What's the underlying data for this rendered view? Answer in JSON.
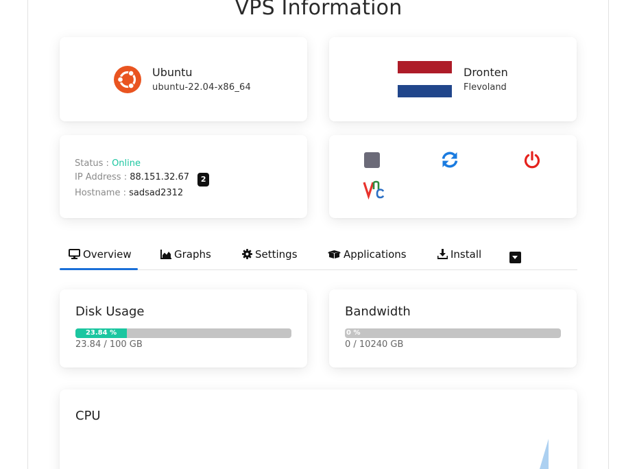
{
  "page": {
    "title": "VPS Information"
  },
  "os": {
    "name": "Ubuntu",
    "image": "ubuntu-22.04-x86_64",
    "icon": "ubuntu-logo-icon"
  },
  "location": {
    "city": "Dronten",
    "region": "Flevoland",
    "flag": "netherlands-flag-icon",
    "flag_colors": [
      "#AE1C28",
      "#FFFFFF",
      "#21468B"
    ]
  },
  "status": {
    "status_label": "Status :",
    "status_value": "Online",
    "ip_label": "IP Address :",
    "ip_value": "88.151.32.67",
    "ip_count": "2",
    "hostname_label": "Hostname :",
    "hostname_value": "sadsad2312"
  },
  "controls": {
    "stop": "stop-icon",
    "restart": "restart-icon",
    "power": "power-icon",
    "vnc": "vnc-icon",
    "colors": {
      "stop": "#6b6a78",
      "restart": "#1a7be0",
      "power": "#e5221d"
    }
  },
  "tabs": [
    {
      "label": "Overview",
      "icon": "monitor-icon",
      "active": true
    },
    {
      "label": "Graphs",
      "icon": "area-chart-icon"
    },
    {
      "label": "Settings",
      "icon": "gear-icon"
    },
    {
      "label": "Applications",
      "icon": "boxes-icon"
    },
    {
      "label": "Install",
      "icon": "download-icon"
    }
  ],
  "disk": {
    "title": "Disk Usage",
    "percent_label": "23.84 %",
    "percent": 23.84,
    "usage": "23.84 / 100 GB"
  },
  "bandwidth": {
    "title": "Bandwidth",
    "percent_label": "0 %",
    "percent": 0,
    "usage": "0 / 10240 GB"
  },
  "cpu": {
    "title": "CPU"
  },
  "colors": {
    "accent": "#1a6fd8",
    "success": "#1bc6a0",
    "bar_track": "#c4c4c4"
  }
}
